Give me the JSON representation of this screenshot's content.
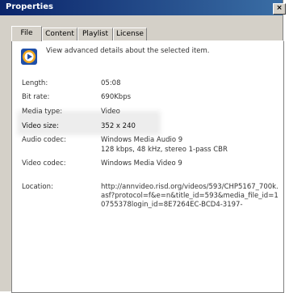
{
  "window": {
    "title": "Properties",
    "close_glyph": "×"
  },
  "tabs": [
    {
      "label": "File",
      "active": true
    },
    {
      "label": "Content",
      "active": false
    },
    {
      "label": "Playlist",
      "active": false
    },
    {
      "label": "License",
      "active": false
    }
  ],
  "header": {
    "icon": "windows-media-file-icon",
    "description": "View advanced details about the selected item."
  },
  "details": {
    "length": {
      "label": "Length:",
      "value": "05:08"
    },
    "bit_rate": {
      "label": "Bit rate:",
      "value": "690Kbps"
    },
    "media_type": {
      "label": "Media type:",
      "value": "Video"
    },
    "video_size": {
      "label": "Video size:",
      "value": "352 x 240"
    },
    "audio_codec": {
      "label": "Audio codec:",
      "value_line1": "Windows Media Audio 9",
      "value_line2": "128 kbps, 48 kHz, stereo 1-pass CBR"
    },
    "video_codec": {
      "label": "Video codec:",
      "value": "Windows Media Video 9"
    },
    "location": {
      "label": "Location:",
      "value": "http://annvideo.risd.org/videos/593/CHP5167_700k.asf?protocol=f&e=n&title_id=593&media_file_id=10755378login_id=8E7264EC-BCD4-3197-"
    }
  }
}
